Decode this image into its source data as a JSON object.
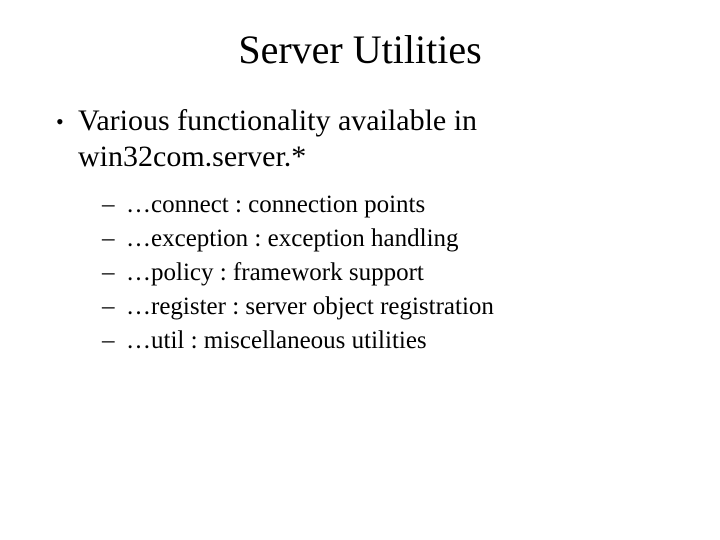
{
  "title": "Server Utilities",
  "main_bullet": "Various functionality available in win32com.server.*",
  "sub_bullets": [
    "…connect : connection points",
    "…exception : exception handling",
    "…policy : framework support",
    "…register : server object registration",
    "…util : miscellaneous utilities"
  ]
}
